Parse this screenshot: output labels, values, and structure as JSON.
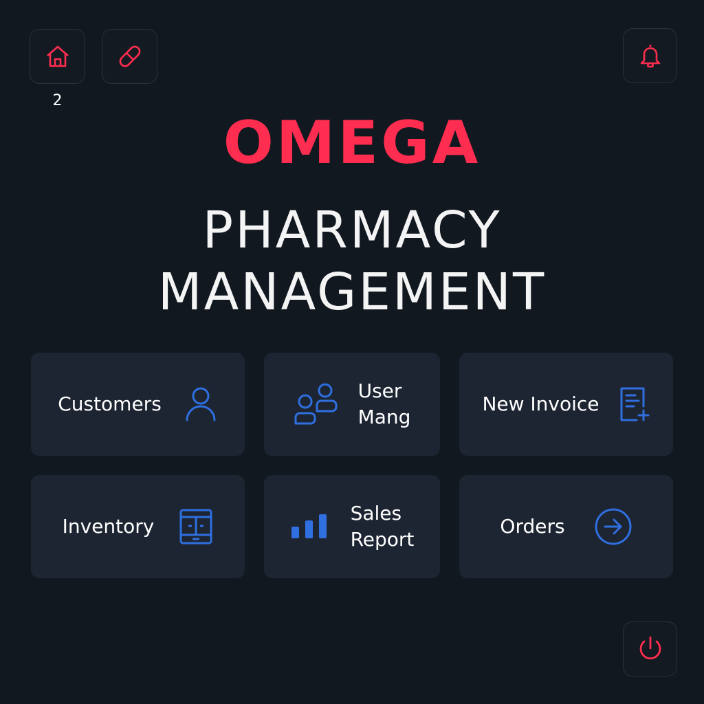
{
  "header": {
    "home_icon": "home-icon",
    "pill_icon": "pill-icon",
    "bell_icon": "bell-icon",
    "notification_count": "2"
  },
  "brand": {
    "name": "OMEGA",
    "subtitle_line1": "PHARMACY",
    "subtitle_line2": "MANAGEMENT"
  },
  "tiles": [
    {
      "label": "Customers",
      "icon": "user-icon"
    },
    {
      "label": "User\nMang",
      "icon": "users-icon"
    },
    {
      "label": "New Invoice",
      "icon": "invoice-add-icon"
    },
    {
      "label": "Inventory",
      "icon": "cabinet-icon"
    },
    {
      "label": "Sales\nReport",
      "icon": "bar-chart-icon"
    },
    {
      "label": "Orders",
      "icon": "arrow-right-circle-icon"
    }
  ],
  "footer": {
    "power_icon": "power-icon"
  },
  "colors": {
    "background": "#121820",
    "accent": "#ff2d4f",
    "tile": "#1d2532",
    "icon_blue": "#2f6fe0"
  }
}
